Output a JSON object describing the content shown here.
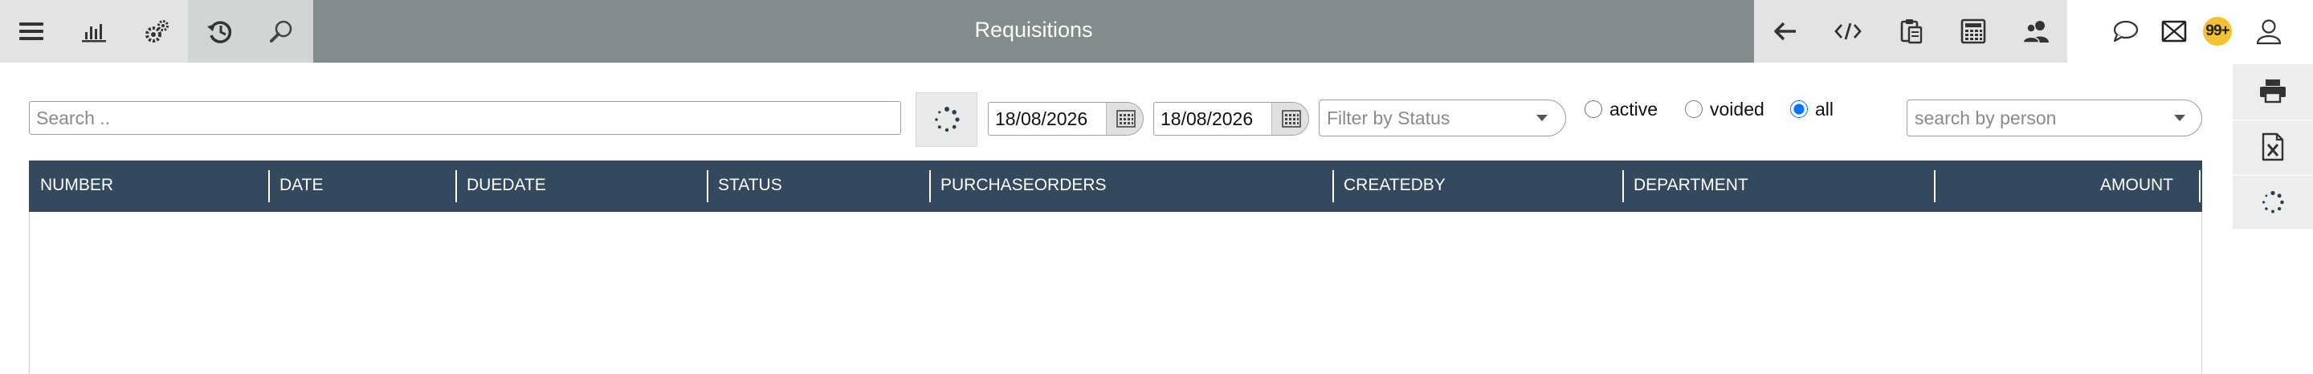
{
  "header": {
    "title": "Requisitions",
    "notification_badge": "99+"
  },
  "toolbar_left": [
    {
      "icon": "menu-icon"
    },
    {
      "icon": "bar-chart-icon"
    },
    {
      "icon": "settings-gears-icon"
    },
    {
      "icon": "history-icon"
    },
    {
      "icon": "search-icon"
    }
  ],
  "toolbar_right": [
    {
      "icon": "back-arrow-icon"
    },
    {
      "icon": "code-icon"
    },
    {
      "icon": "clipboard-icon"
    },
    {
      "icon": "calculator-icon"
    },
    {
      "icon": "user-group-icon"
    },
    {
      "icon": "chat-icon"
    },
    {
      "icon": "mail-icon"
    },
    {
      "icon": "user-icon"
    }
  ],
  "filters": {
    "search_placeholder": "Search ..",
    "date_from": "18/08/2026",
    "date_to": "18/08/2026",
    "status_placeholder": "Filter by Status",
    "radios": [
      {
        "label": "active",
        "checked": false
      },
      {
        "label": "voided",
        "checked": false
      },
      {
        "label": "all",
        "checked": true
      }
    ],
    "person_placeholder": "search by person"
  },
  "table": {
    "columns": [
      "NUMBER",
      "DATE",
      "DUEDATE",
      "STATUS",
      "PURCHASEORDERS",
      "CREATEDBY",
      "DEPARTMENT",
      "AMOUNT"
    ],
    "rows": []
  },
  "side_panel": [
    {
      "icon": "printer-icon"
    },
    {
      "icon": "excel-export-icon"
    },
    {
      "icon": "loading-spinner-icon"
    }
  ],
  "colors": {
    "title_bar": "#828c8c",
    "toolbar": "#e2e4e4",
    "table_header": "#34495e",
    "badge": "#f2c233",
    "radio_accent": "#1a73e8"
  }
}
